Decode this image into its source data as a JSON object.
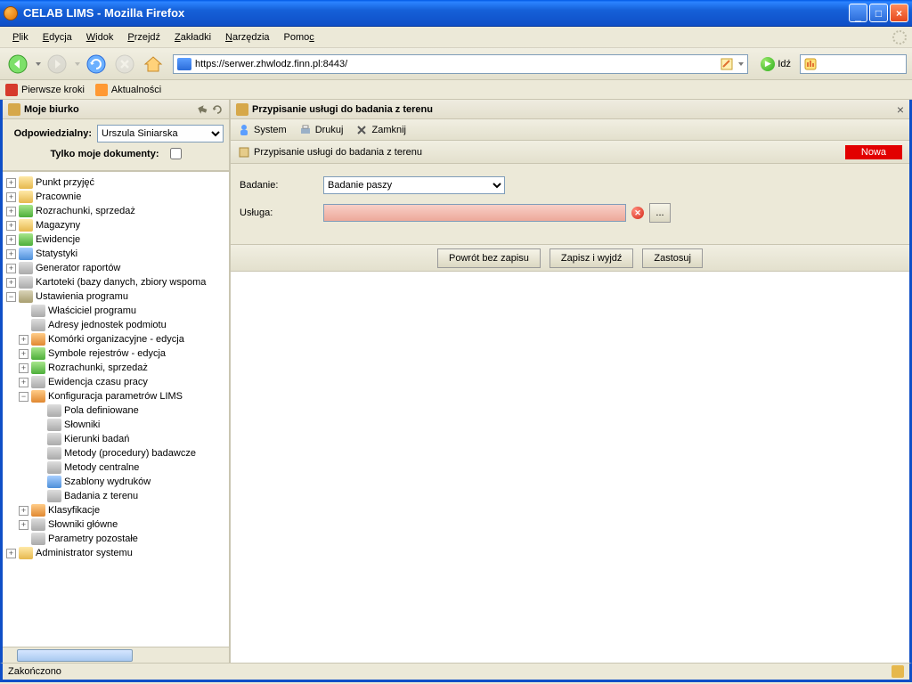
{
  "window": {
    "title": "CELAB LIMS - Mozilla Firefox"
  },
  "menu": {
    "file": "Plik",
    "edit": "Edycja",
    "view": "Widok",
    "go": "Przejdź",
    "bookmarks": "Zakładki",
    "tools": "Narzędzia",
    "help": "Pomoc"
  },
  "nav": {
    "url": "https://serwer.zhwlodz.finn.pl:8443/",
    "go": "Idź"
  },
  "bookmarks": {
    "first": "Pierwsze kroki",
    "news": "Aktualności"
  },
  "side": {
    "title": "Moje biurko",
    "resp_label": "Odpowiedzialny:",
    "resp_value": "Urszula Siniarska",
    "mydocs_label": "Tylko moje dokumenty:",
    "tree": {
      "n1": "Punkt przyjęć",
      "n2": "Pracownie",
      "n3": "Rozrachunki, sprzedaż",
      "n4": "Magazyny",
      "n5": "Ewidencje",
      "n6": "Statystyki",
      "n7": "Generator raportów",
      "n8": "Kartoteki (bazy danych, zbiory wspoma",
      "n9": "Ustawienia programu",
      "n9a": "Właściciel programu",
      "n9b": "Adresy jednostek podmiotu",
      "n9c": "Komórki organizacyjne - edycja",
      "n9d": "Symbole rejestrów - edycja",
      "n9e": "Rozrachunki, sprzedaż",
      "n9f": "Ewidencja czasu pracy",
      "n9g": "Konfiguracja parametrów LIMS",
      "n9g1": "Pola definiowane",
      "n9g2": "Słowniki",
      "n9g3": "Kierunki badań",
      "n9g4": "Metody (procedury) badawcze",
      "n9g5": "Metody centralne",
      "n9g6": "Szablony wydruków",
      "n9g7": "Badania z terenu",
      "n9h": "Klasyfikacje",
      "n9i": "Słowniki główne",
      "n9j": "Parametry pozostałe",
      "n10": "Administrator systemu"
    }
  },
  "content": {
    "title": "Przypisanie usługi do badania z terenu",
    "toolbar": {
      "system": "System",
      "print": "Drukuj",
      "close": "Zamknij"
    },
    "tab": "Przypisanie usługi do badania z terenu",
    "nowa": "Nowa",
    "form": {
      "badanie_label": "Badanie:",
      "badanie_value": "Badanie paszy",
      "usluga_label": "Usługa:",
      "browse": "..."
    },
    "actions": {
      "back": "Powrót bez zapisu",
      "save": "Zapisz i wyjdź",
      "apply": "Zastosuj"
    }
  },
  "status": {
    "text": "Zakończono"
  }
}
